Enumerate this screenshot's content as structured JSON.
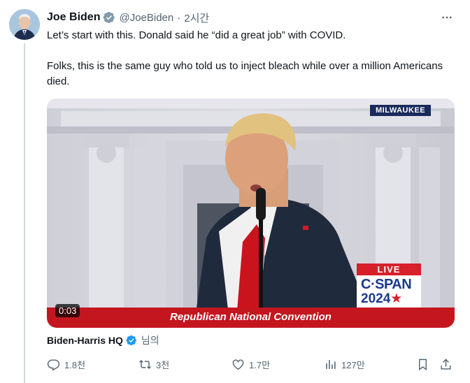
{
  "post": {
    "author_name": "Joe Biden",
    "author_handle": "@JoeBiden",
    "separator": "·",
    "time": "2시간",
    "text_line1": "Let’s start with this. Donald said he “did a great job” with COVID.",
    "text_line2": "Folks, this is the same guy who told us to inject bleach while over a million Americans died."
  },
  "media": {
    "location_badge": "MILWAUKEE",
    "live_label": "LIVE",
    "network_line1": "C·SPAN",
    "network_year_a": "2024",
    "network_year_b": "★",
    "banner_text": "Republican National Convention",
    "video_time": "0:03"
  },
  "attribution": {
    "name": "Biden-Harris HQ",
    "suffix": "님의"
  },
  "actions": {
    "replies": "1.8천",
    "reposts": "3천",
    "likes": "1.7만",
    "views": "127만"
  },
  "colors": {
    "verified_gray": "#829aab",
    "verified_blue": "#1d9bf0",
    "banner_red": "#c4161f",
    "muted_text": "#536471"
  },
  "icons": [
    "more-icon",
    "verified-gray-icon",
    "verified-blue-icon",
    "reply-icon",
    "repost-icon",
    "like-icon",
    "views-icon",
    "bookmark-icon",
    "share-icon"
  ]
}
